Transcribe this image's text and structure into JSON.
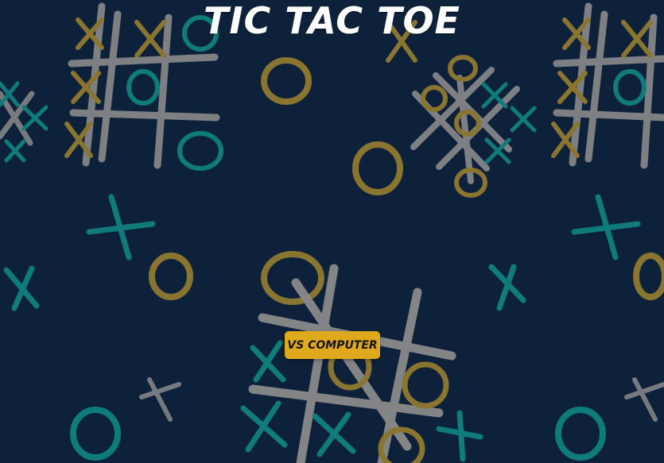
{
  "app": {
    "title": "TIC TAC TOE"
  },
  "menu": {
    "vs_computer_label": "VS COMPUTER"
  },
  "colors": {
    "background": "#0d223a",
    "accent": "#e0a81c",
    "grid": "#8a8a8a",
    "teal": "#0f7b7a",
    "gold": "#8a7530"
  },
  "background_icons": [
    "hash-grid-icon",
    "x-mark-icon",
    "o-mark-icon"
  ]
}
